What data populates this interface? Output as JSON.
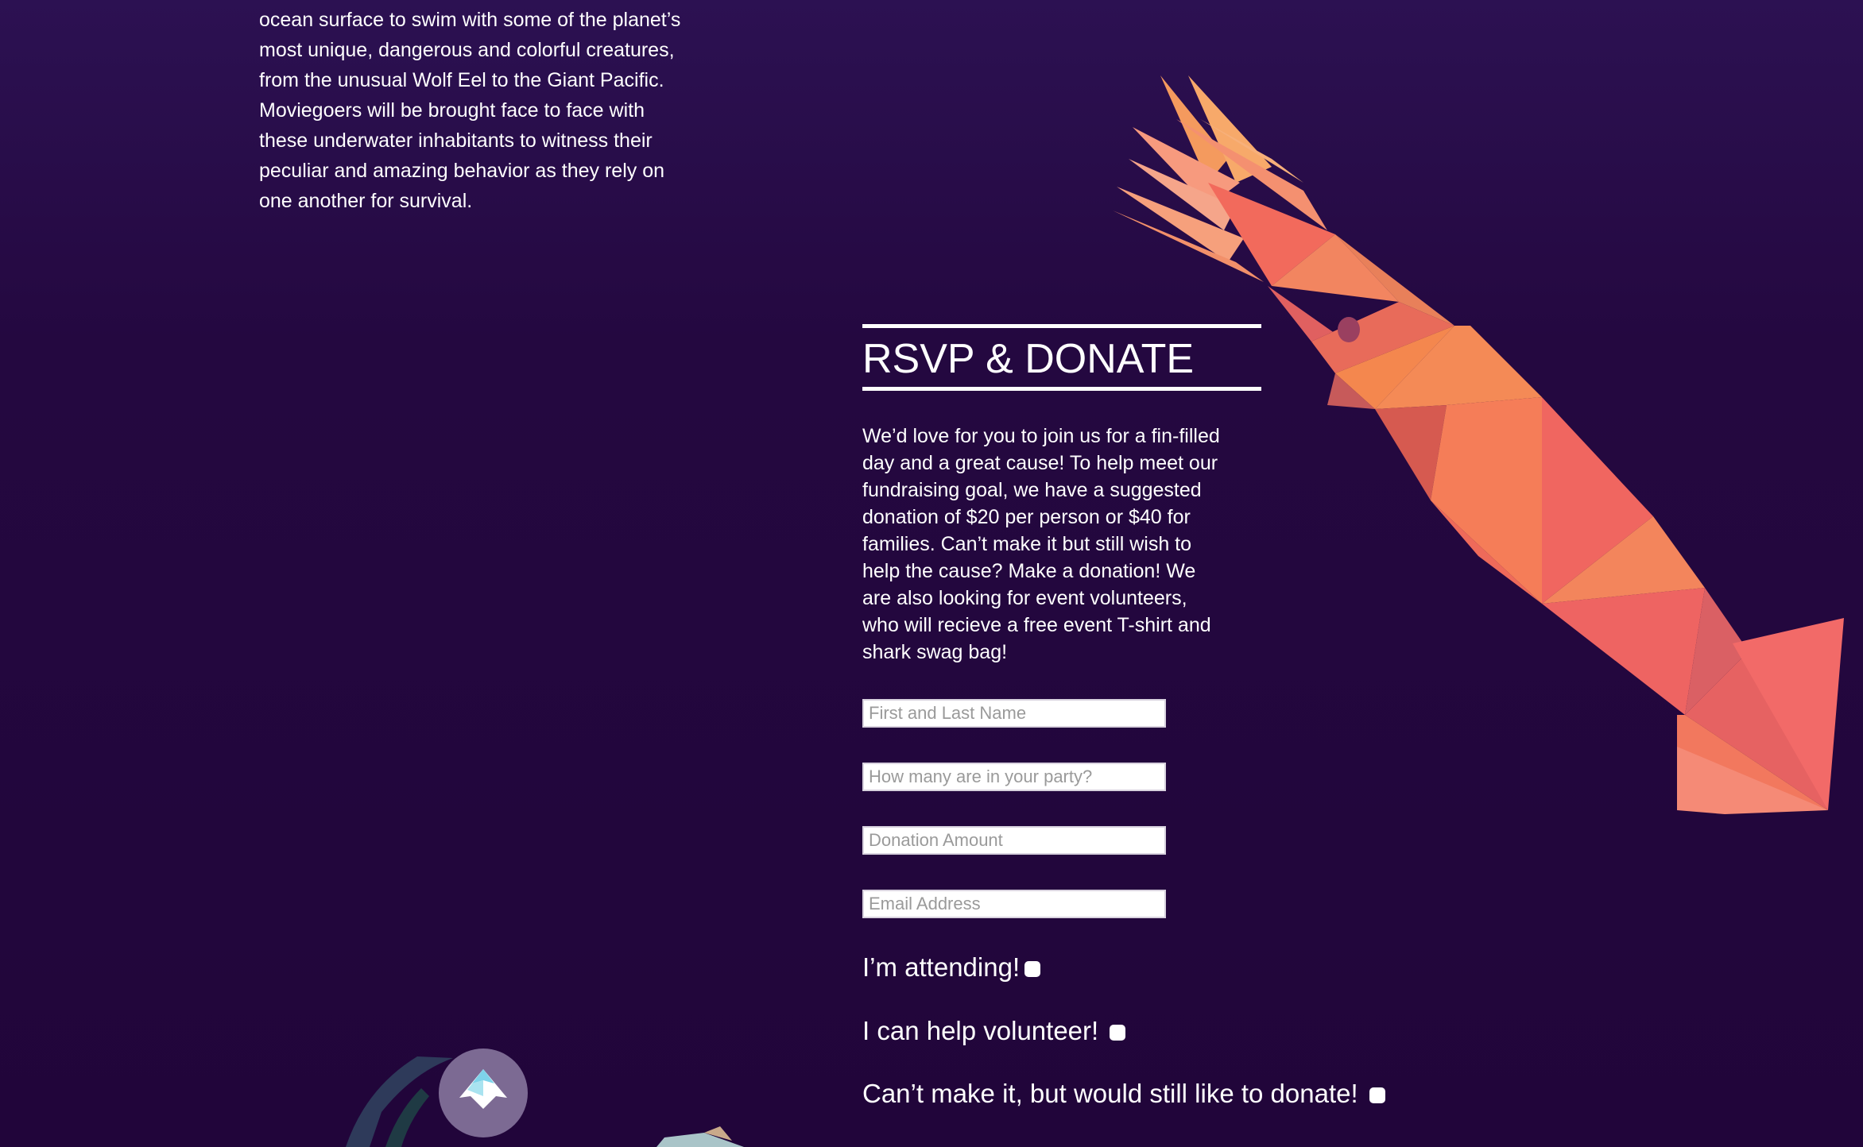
{
  "intro": {
    "text": "ocean surface to swim with some of the planet’s most unique, dangerous and colorful creatures, from the unusual Wolf Eel to the Giant Pacific. Moviegoers will be brought face to face with these underwater inhabitants to witness their peculiar and amazing behavior as they rely on one another for survival."
  },
  "rsvp": {
    "heading": "RSVP & DONATE",
    "body": "We’d love for you to join us for a fin-filled day and a great cause! To help meet our fundraising goal, we have a suggested donation of $20 per person or $40 for families. Can’t make it but still wish to help the cause? Make a donation! We are also looking for event volunteers, who will recieve a free event T-shirt and shark swag bag!"
  },
  "form": {
    "name_placeholder": "First and Last Name",
    "party_placeholder": "How many are in your party?",
    "donation_placeholder": "Donation Amount",
    "email_placeholder": "Email Address",
    "attending_label": "I’m attending!",
    "volunteer_label": "I can help volunteer!",
    "donate_label": "Can’t make it, but would still like to donate!"
  },
  "colors": {
    "background": "#240840",
    "squid_main": "#f2695e",
    "squid_light": "#f7a07a",
    "squid_orange": "#f4864e"
  },
  "icons": {
    "squid": "squid-illustration",
    "scroll_top": "up-arrow-fish-icon"
  }
}
